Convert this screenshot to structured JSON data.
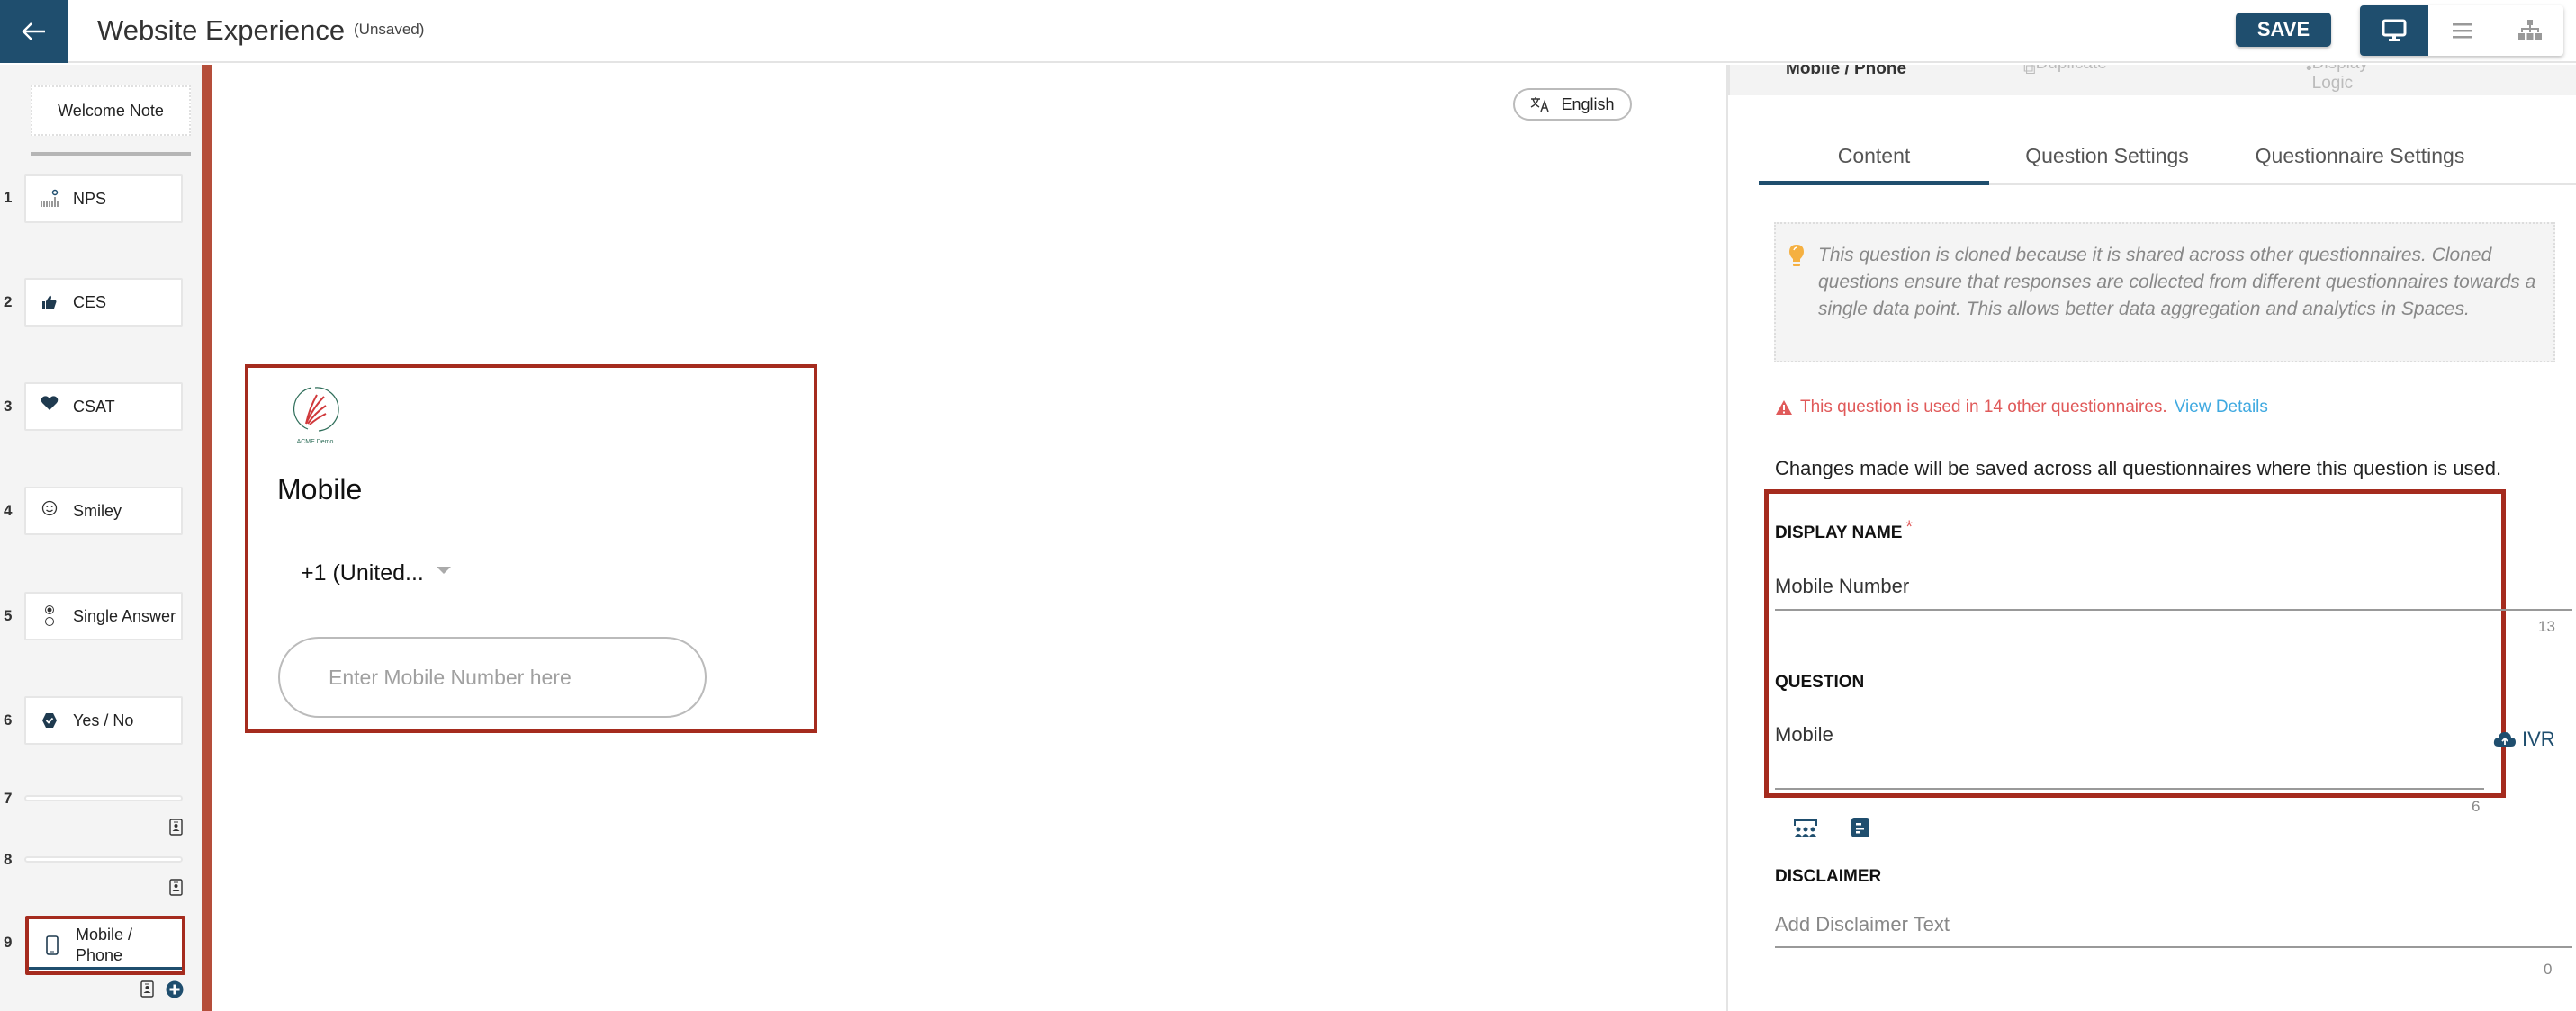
{
  "header": {
    "title": "Website Experience",
    "status": "(Unsaved)",
    "save_label": "SAVE",
    "view_modes": [
      {
        "name": "desktop-view",
        "icon": "monitor-icon",
        "active": true
      },
      {
        "name": "list-view",
        "icon": "list-icon",
        "active": false
      },
      {
        "name": "flow-view",
        "icon": "sitemap-icon",
        "active": false
      }
    ]
  },
  "sidebar": {
    "welcome_label": "Welcome Note",
    "questions": [
      {
        "num": "1",
        "label": "NPS",
        "icon": "nps-icon"
      },
      {
        "num": "2",
        "label": "CES",
        "icon": "thumbs-up-icon"
      },
      {
        "num": "3",
        "label": "CSAT",
        "icon": "heart-icon"
      },
      {
        "num": "4",
        "label": "Smiley",
        "icon": "smiley-icon"
      },
      {
        "num": "5",
        "label": "Single Answer",
        "icon": "radio-icon"
      },
      {
        "num": "6",
        "label": "Yes / No",
        "icon": "check-badge-icon"
      },
      {
        "num": "7",
        "label": "",
        "icon": "contact-card-icon"
      },
      {
        "num": "8",
        "label": "",
        "icon": "contact-card-icon"
      },
      {
        "num": "9",
        "label_line1": "Mobile /",
        "label_line2": "Phone",
        "icon": "mobile-icon",
        "selected": true
      }
    ]
  },
  "preview": {
    "language": "English",
    "logo_caption": "ACME Demo",
    "question_title": "Mobile",
    "country_code": "+1 (United...",
    "phone_placeholder": "Enter Mobile Number here"
  },
  "right_panel": {
    "top_strip": {
      "question_name": "Mobile / Phone",
      "duplicate": "Duplicate",
      "display_logic": "Display Logic"
    },
    "tabs": [
      "Content",
      "Question Settings",
      "Questionnaire Settings"
    ],
    "active_tab": "Content",
    "info_text": "This question is cloned because it is shared across other questionnaires. Cloned questions ensure that responses are collected from different questionnaires towards a single data point. This allows better data aggregation and analytics in Spaces.",
    "warning_text": "This question is used in 14 other questionnaires.",
    "warning_link": "View Details",
    "changes_note": "Changes made will be saved across all questionnaires where this question is used.",
    "display_name": {
      "label": "DISPLAY NAME",
      "required_mark": "*",
      "value": "Mobile Number",
      "count": "13"
    },
    "question": {
      "label": "QUESTION",
      "value": "Mobile",
      "count": "6",
      "ivr_label": "IVR"
    },
    "disclaimer": {
      "label": "DISCLAIMER",
      "placeholder": "Add Disclaimer Text",
      "value": "",
      "count": "0"
    },
    "colors": {
      "primary": "#1f4e6e",
      "highlight": "#a52b1e",
      "warning": "#e05a5a",
      "link": "#3fa9e0",
      "bulb": "#f5b041"
    }
  }
}
